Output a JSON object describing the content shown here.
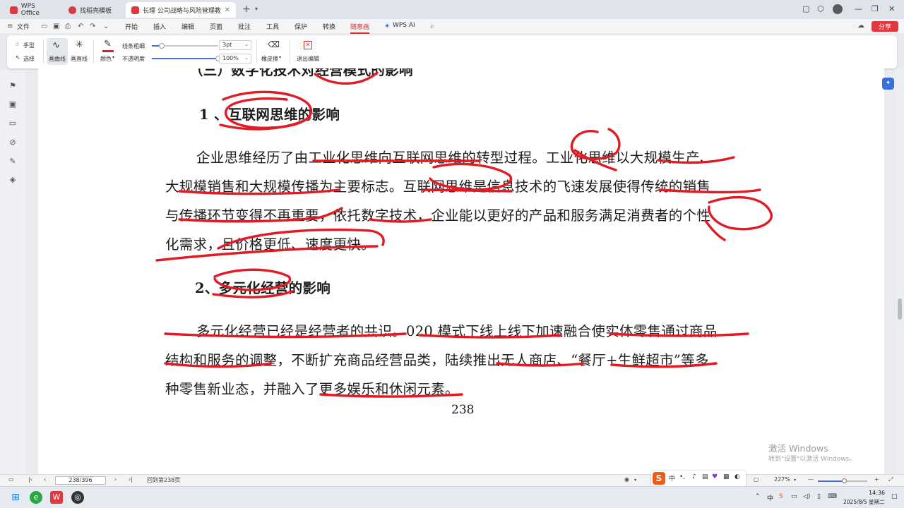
{
  "tabs": [
    {
      "label": "WPS Office",
      "icon": "wps-logo-icon",
      "color": "#e0383e"
    },
    {
      "label": "找稻壳模板",
      "icon": "docer-icon",
      "color": "#e0383e"
    },
    {
      "label": "长理 公司战略与风险管理教",
      "icon": "pdf-icon",
      "color": "#e0383e"
    }
  ],
  "menu": {
    "file": "文件",
    "items": [
      "开始",
      "插入",
      "编辑",
      "页面",
      "批注",
      "工具",
      "保护",
      "转换",
      "随意画"
    ],
    "active_index": 8,
    "ai": "WPS AI",
    "share": "分享"
  },
  "ribbon": {
    "hand": "手型",
    "select": "选择",
    "draw_curve": "画曲线",
    "draw_line": "画直线",
    "color": "颜色",
    "line_width_label": "线条粗细",
    "line_width_value": "3pt",
    "opacity_label": "不透明度",
    "opacity_value": "100%",
    "eraser": "橡皮擦",
    "exit_edit": "退出编辑",
    "ink_color": "#e01b24",
    "line_width_fraction": 0.15,
    "opacity_fraction": 1.0
  },
  "doc": {
    "top_partial": "（三）数字化技术对经营模式的影响",
    "heading1": "1 、互联网思维的影响",
    "p1_lines": [
      "企业思维经历了由工业化思维向互联网思维的转型过程。工业化思维以大规模生产、",
      "大规模销售和大规模传播为主要标志。互联网思维是信息技术的飞速发展使得传统的销售",
      "与传播环节变得不再重要，依托数字技术，企业能以更好的产品和服务满足消费者的个性",
      "化需求，且价格更低、速度更快。"
    ],
    "heading2": "2、多元化经营的影响",
    "p2_lines": [
      "多元化经营已经是经营者的共识。020 模式下线上线下加速融合使实体零售通过商品",
      "结构和服务的调整，不断扩充商品经营品类，陆续推出无人商店、“餐厅+生鲜超市”等多",
      "种零售新业态，并融入了更多娱乐和休闲元素。"
    ],
    "page_number": "238"
  },
  "watermark": {
    "line1": "激活 Windows",
    "line2": "转到\"设置\"以激活 Windows。"
  },
  "status": {
    "page_field": "238/396",
    "goto": "回到第238页",
    "zoom": "227%"
  },
  "ime": {
    "logo": "S",
    "lang": "中",
    "punct": "•,"
  },
  "clock": {
    "time": "14:36",
    "date": "2025/8/5 星期二"
  }
}
